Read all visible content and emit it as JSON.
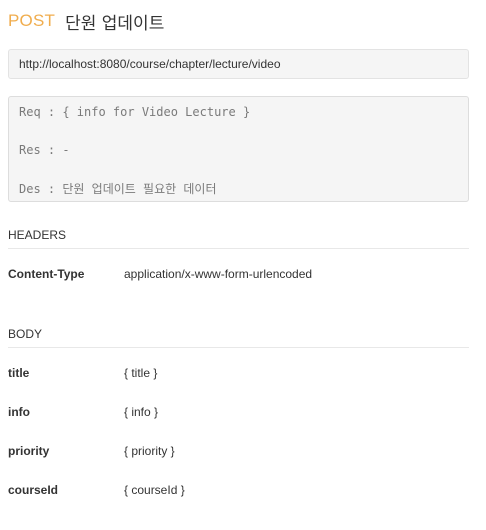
{
  "endpoint": {
    "method": "POST",
    "title": "단원 업데이트",
    "url": "http://localhost:8080/course/chapter/lecture/video"
  },
  "description": {
    "req": "Req : { info for Video Lecture }",
    "res": "Res : -",
    "des": "Des : 단원 업데이트 필요한 데이터"
  },
  "headers": {
    "title": "HEADERS",
    "rows": [
      {
        "key": "Content-Type",
        "value": "application/x-www-form-urlencoded"
      }
    ]
  },
  "body": {
    "title": "BODY",
    "rows": [
      {
        "key": "title",
        "value": "{ title }"
      },
      {
        "key": "info",
        "value": "{ info }"
      },
      {
        "key": "priority",
        "value": "{ priority }"
      },
      {
        "key": "courseId",
        "value": "{ courseId }"
      }
    ]
  },
  "colors": {
    "method": "#f0ad4e",
    "box_background": "#f5f5f5"
  }
}
